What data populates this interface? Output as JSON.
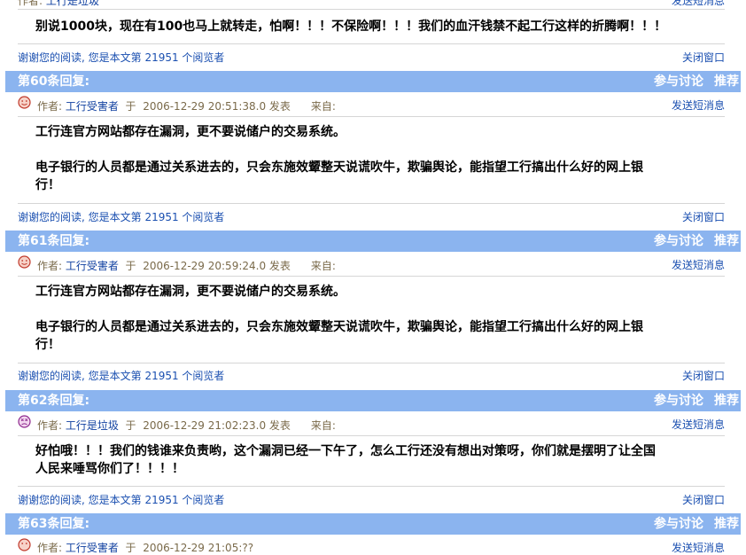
{
  "top_partial": {
    "author_label": "作者:",
    "author_name": "工行是垃圾",
    "message_link": "发送短消息",
    "body": "别说1000块，现在有100也马上就转走，怕啊！！！不保险啊！！！我们的血汗钱禁不起工行这样的折腾啊！！！",
    "footer_thanks": "谢谢您的阅读,  您是本文第  21951  个阅览者",
    "close_link": "关闭窗口"
  },
  "posts": [
    {
      "reply_label": "第60条回复:",
      "author_label": "作者:",
      "author": "工行受害者",
      "at_label": "于",
      "timestamp": "2006-12-29 20:51:38.0",
      "posted_label": "发表",
      "from_label": "来自:",
      "message_link": "发送短消息",
      "avatar": "smile-icon",
      "body": "工行连官方网站都存在漏洞，更不要说储户的交易系统。\n\n电子银行的人员都是通过关系进去的，只会东施效颦整天说谎吹牛，欺骗舆论，能指望工行搞出什么好的网上银\n行！",
      "footer_thanks": "谢谢您的阅读,  您是本文第  21951  个阅览者",
      "close_link": "关闭窗口"
    },
    {
      "reply_label": "第61条回复:",
      "author_label": "作者:",
      "author": "工行受害者",
      "at_label": "于",
      "timestamp": "2006-12-29 20:59:24.0",
      "posted_label": "发表",
      "from_label": "来自:",
      "message_link": "发送短消息",
      "avatar": "smile-icon",
      "body": "工行连官方网站都存在漏洞，更不要说储户的交易系统。\n\n电子银行的人员都是通过关系进去的，只会东施效颦整天说谎吹牛，欺骗舆论，能指望工行搞出什么好的网上银\n行！",
      "footer_thanks": "谢谢您的阅读,  您是本文第  21951  个阅览者",
      "close_link": "关闭窗口"
    },
    {
      "reply_label": "第62条回复:",
      "author_label": "作者:",
      "author": "工行是垃圾",
      "at_label": "于",
      "timestamp": "2006-12-29 21:02:23.0",
      "posted_label": "发表",
      "from_label": "来自:",
      "message_link": "发送短消息",
      "avatar": "angry-face-icon",
      "body": "好怕哦！！！我们的钱谁来负责哟，这个漏洞已经一下午了，怎么工行还没有想出对策呀，你们就是摆明了让全国\n人民来唾骂你们了！！！！",
      "footer_thanks": "谢谢您的阅读,  您是本文第  21951  个阅览者",
      "close_link": "关闭窗口"
    }
  ],
  "next_bar": {
    "reply_label": "第63条回复:",
    "author_label": "作者:",
    "author": "工行受害者",
    "at_label": "于",
    "timestamp": "2006-12-29 21:05:??",
    "message_link": "发送短消息"
  },
  "bar_actions": {
    "discuss": "参与讨论",
    "recommend": "推荐"
  },
  "colors": {
    "bar": "#8bb4ef",
    "link": "#1a4fb0",
    "meta": "#7a6a4a"
  }
}
